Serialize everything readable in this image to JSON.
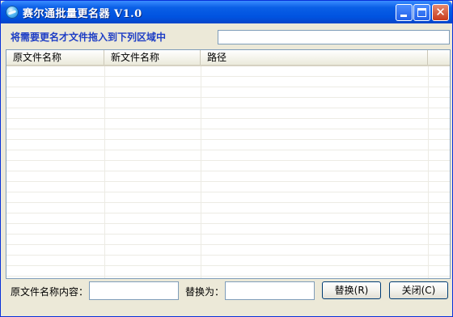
{
  "window": {
    "title": "赛尔通批量更名器  V1.0"
  },
  "titlebar_buttons": {
    "minimize": "minimize-icon",
    "maximize": "maximize-icon",
    "close": "close-icon",
    "close_glyph": "✕"
  },
  "instruction": {
    "text": "将需要更名才文件拖入到下列区域中"
  },
  "top_input": {
    "value": ""
  },
  "list": {
    "columns": [
      "原文件名称",
      "新文件名称",
      "路径"
    ],
    "rows": []
  },
  "bottom": {
    "original_label": "原文件名称内容：",
    "original_value": "",
    "replace_label": "替换为：",
    "replace_value": "",
    "replace_button": "替换(R)",
    "close_button": "关闭(C)"
  },
  "colors": {
    "titlebar": "#0053e0",
    "instruction_text": "#1e3ec5",
    "window_bg": "#ece9d8"
  }
}
